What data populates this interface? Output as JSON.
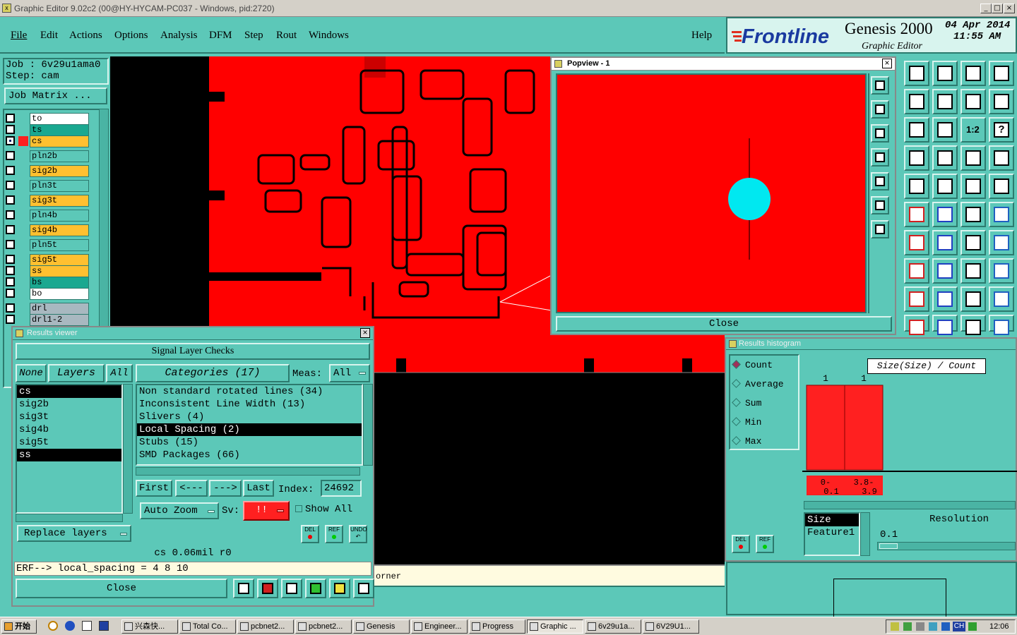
{
  "window": {
    "title": "Graphic Editor 9.02c2 (00@HY-HYCAM-PC037 - Windows, pid:2720)"
  },
  "menu": {
    "items": [
      "File",
      "Edit",
      "Actions",
      "Options",
      "Analysis",
      "DFM",
      "Step",
      "Rout",
      "Windows"
    ],
    "help": "Help"
  },
  "brand": {
    "logo": "Frontline",
    "product": "Genesis 2000",
    "subtitle": "Graphic Editor",
    "date": "04 Apr 2014",
    "time": "11:55 AM"
  },
  "job": {
    "job_label": "Job : 6v29u1ama0",
    "step_label": "Step: cam",
    "matrix_button": "Job Matrix ..."
  },
  "layers": [
    {
      "name": "to",
      "color": "#ffffff"
    },
    {
      "name": "ts",
      "color": "#1aa890"
    },
    {
      "name": "cs",
      "color": "#ffc030"
    },
    {
      "name": "pln2b",
      "color": "#5cc8b8"
    },
    {
      "name": "sig2b",
      "color": "#ffc030"
    },
    {
      "name": "pln3t",
      "color": "#5cc8b8"
    },
    {
      "name": "sig3t",
      "color": "#ffc030"
    },
    {
      "name": "pln4b",
      "color": "#5cc8b8"
    },
    {
      "name": "sig4b",
      "color": "#ffc030"
    },
    {
      "name": "pln5t",
      "color": "#5cc8b8"
    },
    {
      "name": "sig5t",
      "color": "#ffc030"
    },
    {
      "name": "ss",
      "color": "#ffc030"
    },
    {
      "name": "bs",
      "color": "#1aa890"
    },
    {
      "name": "bo",
      "color": "#ffffff"
    },
    {
      "name": "drl",
      "color": "#a8b8c0"
    },
    {
      "name": "drl1-2",
      "color": "#a8b8c0"
    }
  ],
  "popview": {
    "title": "Popview - 1",
    "close": "Close"
  },
  "results": {
    "title": "Results viewer",
    "header": "Signal Layer Checks",
    "none_btn": "None",
    "layers_btn": "Layers",
    "all_btn": "All",
    "categories_btn": "Categories (17)",
    "meas_label": "Meas:",
    "meas_value": "All",
    "layer_list": [
      {
        "name": "cs",
        "selected": true
      },
      {
        "name": "sig2b",
        "selected": false
      },
      {
        "name": "sig3t",
        "selected": false
      },
      {
        "name": "sig4b",
        "selected": false
      },
      {
        "name": "sig5t",
        "selected": false
      },
      {
        "name": "ss",
        "selected": true
      }
    ],
    "categories": [
      {
        "name": "Non standard rotated lines (34)",
        "selected": false
      },
      {
        "name": "Inconsistent Line Width (13)",
        "selected": false
      },
      {
        "name": "Slivers (4)",
        "selected": false
      },
      {
        "name": "Local Spacing (2)",
        "selected": true
      },
      {
        "name": "Stubs (15)",
        "selected": false
      },
      {
        "name": "SMD Packages (66)",
        "selected": false
      }
    ],
    "first": "First",
    "prev": "<---",
    "next": "--->",
    "last": "Last",
    "index_label": "Index:",
    "index_value": "24692",
    "auto_zoom": "Auto Zoom",
    "sv_label": "Sv:",
    "sv_value": "!!",
    "show_all": "Show All",
    "del": "DEL",
    "ref": "REF",
    "undo": "UNDO",
    "replace_layers": "Replace layers",
    "status": "cs 0.06mil  r0",
    "erf": "ERF--> local_spacing = 4 8 10",
    "close": "Close"
  },
  "canvas": {
    "status_text": "orner"
  },
  "histogram": {
    "title": "Results histogram",
    "modes": [
      {
        "name": "Count",
        "selected": true
      },
      {
        "name": "Average",
        "selected": false
      },
      {
        "name": "Sum",
        "selected": false
      },
      {
        "name": "Min",
        "selected": false
      },
      {
        "name": "Max",
        "selected": false
      }
    ],
    "axis_title": "Size(Size) / Count",
    "bars": [
      {
        "count": "1",
        "label_top": "0-",
        "label_bot": "0.1"
      },
      {
        "count": "1",
        "label_top": "3.8-",
        "label_bot": "3.9"
      }
    ],
    "list": [
      {
        "name": "Size",
        "selected": true
      },
      {
        "name": "Feature1",
        "selected": false
      }
    ],
    "resolution_label": "Resolution",
    "resolution_value": "0.1",
    "del": "DEL",
    "ref": "REF"
  },
  "tools": {
    "one_two": "1:2",
    "question": "?"
  },
  "taskbar": {
    "start": "开始",
    "tasks": [
      "兴森快...",
      "Total Co...",
      "pcbnet2...",
      "pcbnet2...",
      "Genesis",
      "Engineer...",
      "Progress",
      "Graphic ...",
      "6v29u1a...",
      "6V29U1..."
    ],
    "tray_lang": "CH",
    "clock": "12:06"
  }
}
